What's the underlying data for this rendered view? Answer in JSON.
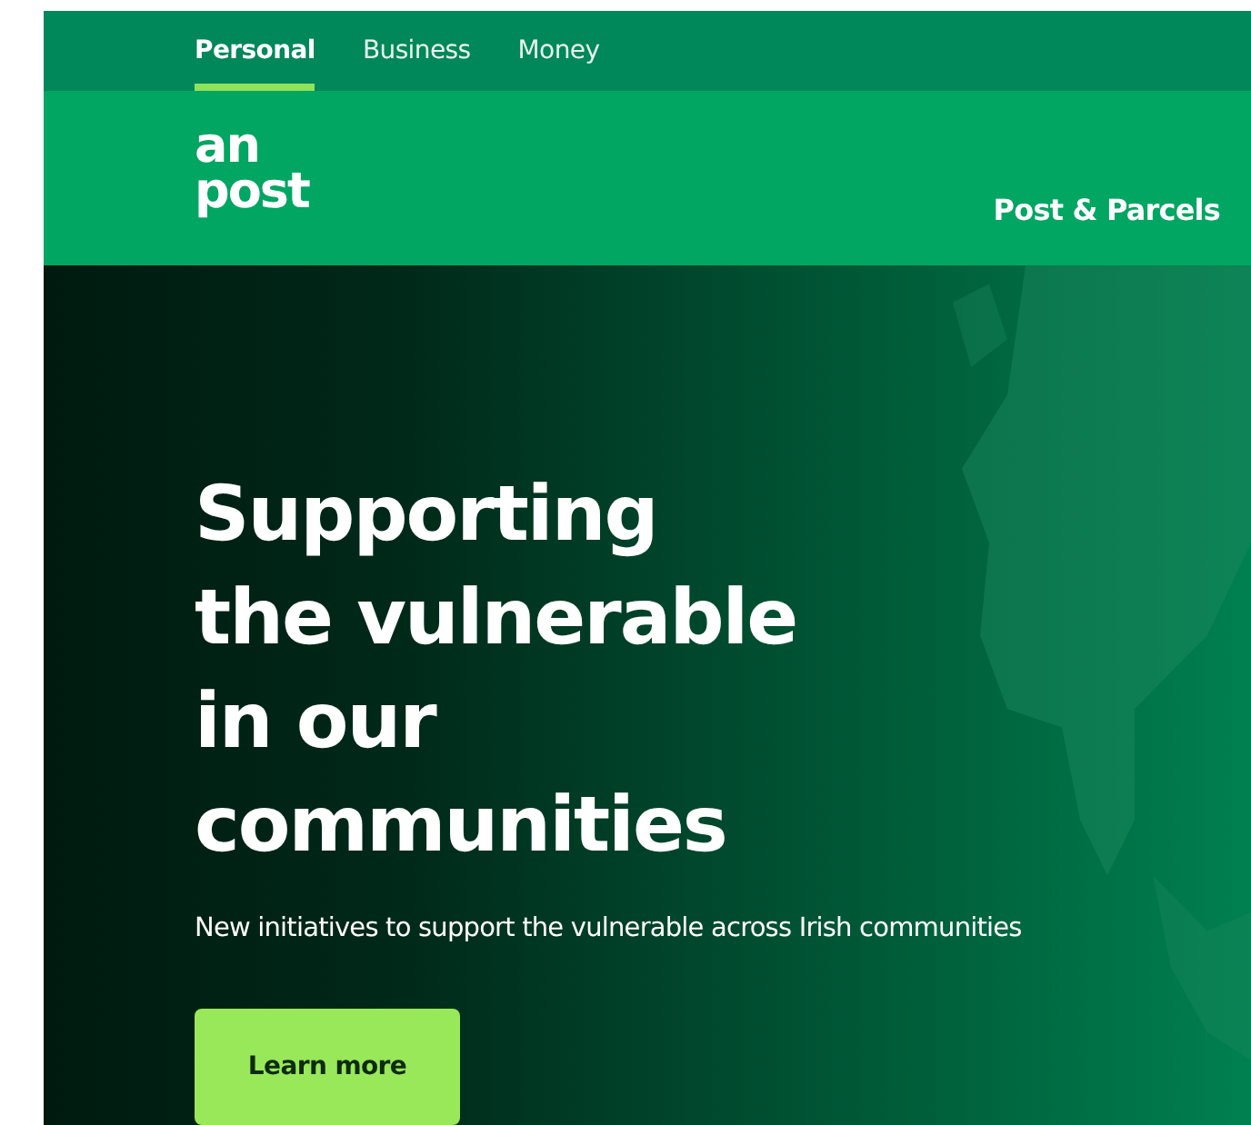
{
  "top_nav": {
    "tabs": [
      {
        "label": "Personal",
        "selected": true
      },
      {
        "label": "Business",
        "selected": false
      },
      {
        "label": "Money",
        "selected": false
      }
    ]
  },
  "header": {
    "logo": "an post",
    "link": "Post & Parcels"
  },
  "hero": {
    "kind": "picture",
    "title": "Supporting the vulnerable in our communities",
    "subtitle": "New initiatives to support the vulnerable across Irish communities",
    "button": "Learn more"
  }
}
